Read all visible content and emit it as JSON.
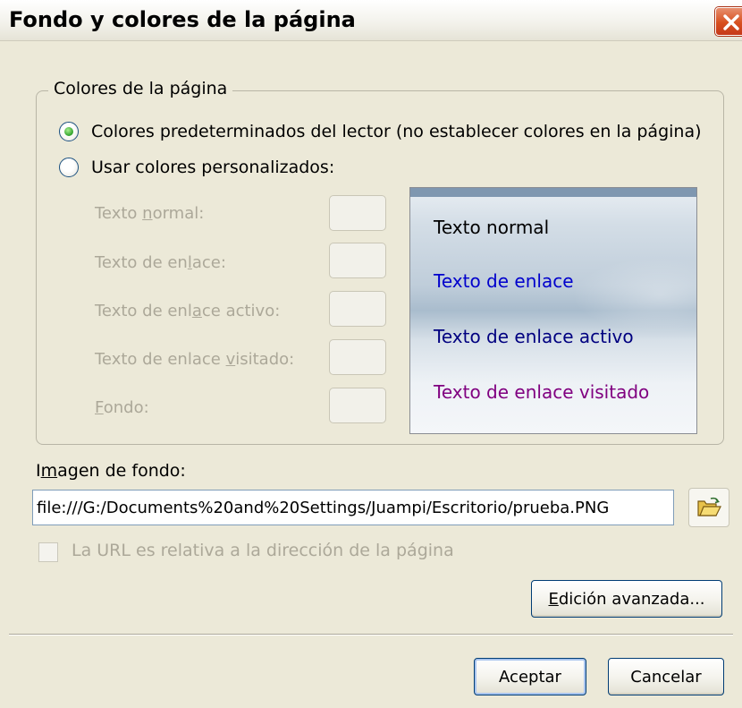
{
  "window": {
    "title": "Fondo y colores de la página"
  },
  "colors_group": {
    "legend": "Colores de la página",
    "radio_default": "Colores predeterminados del lector (no establecer colores en la página)",
    "radio_custom": "Usar colores personalizados:",
    "selected": "default",
    "fields": {
      "normal": {
        "before": "Texto ",
        "key": "n",
        "after": "ormal:"
      },
      "link": {
        "before": "Texto de en",
        "key": "l",
        "after": "ace:"
      },
      "active": {
        "before": "Texto de enl",
        "key": "a",
        "after": "ce activo:"
      },
      "visited": {
        "before": "Texto de enlace ",
        "key": "v",
        "after": "isitado:"
      },
      "background": {
        "before": "",
        "key": "F",
        "after": "ondo:"
      }
    },
    "preview": {
      "normal": "Texto normal",
      "link": "Texto de enlace",
      "active": "Texto de enlace activo",
      "visited": "Texto de enlace visitado"
    },
    "preview_colors": {
      "normal": "#000000",
      "link": "#0000cc",
      "active": "#000080",
      "visited": "#800080"
    }
  },
  "background_image": {
    "label_before": "I",
    "label_key": "m",
    "label_after": "agen de fondo:",
    "url": "file:///G:/Documents%20and%20Settings/Juampi/Escritorio/prueba.PNG",
    "relative_checkbox": "La URL es relativa a la dirección de la página",
    "relative_checked": false
  },
  "buttons": {
    "advanced_key": "E",
    "advanced_rest": "dición avanzada...",
    "ok": "Aceptar",
    "cancel": "Cancelar"
  },
  "icons": [
    "close-icon",
    "open-folder-icon"
  ]
}
